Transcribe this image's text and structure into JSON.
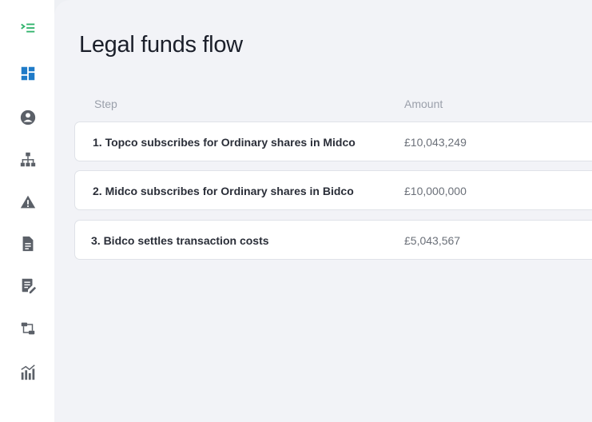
{
  "sidebar": {
    "items": [
      {
        "icon": "expand-menu-icon",
        "color": "#2fb36b"
      },
      {
        "icon": "dashboard-icon",
        "color": "#1f7bc8"
      },
      {
        "icon": "user-icon",
        "color": "#5b6068"
      },
      {
        "icon": "org-structure-icon",
        "color": "#5b6068"
      },
      {
        "icon": "warning-icon",
        "color": "#5b6068"
      },
      {
        "icon": "document-icon",
        "color": "#5b6068"
      },
      {
        "icon": "edit-document-icon",
        "color": "#5b6068"
      },
      {
        "icon": "transfer-icon",
        "color": "#5b6068"
      },
      {
        "icon": "analytics-icon",
        "color": "#5b6068"
      }
    ]
  },
  "main": {
    "title": "Legal funds flow",
    "table": {
      "columns": [
        "Step",
        "Amount"
      ],
      "rows": [
        {
          "step": "1.  Topco subscribes for Ordinary shares in Midco",
          "amount": "£10,043,249"
        },
        {
          "step": "2.  Midco subscribes for Ordinary shares in Bidco",
          "amount": "£10,000,000"
        },
        {
          "step": "3. Bidco settles transaction costs",
          "amount": "£5,043,567"
        }
      ]
    }
  }
}
